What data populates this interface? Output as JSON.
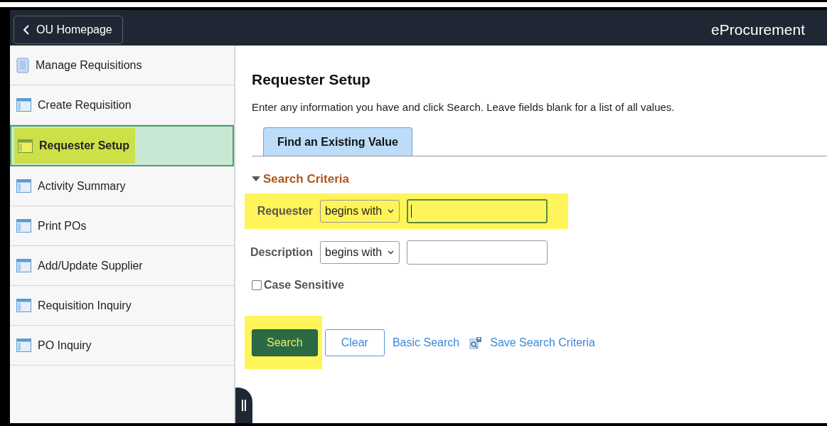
{
  "header": {
    "back_button": "OU Homepage",
    "title": "eProcurement"
  },
  "sidebar": {
    "items": [
      {
        "label": "Manage Requisitions",
        "kind": "list",
        "selected": false
      },
      {
        "label": "Create Requisition",
        "kind": "page",
        "selected": false
      },
      {
        "label": "Requester Setup",
        "kind": "page",
        "selected": true
      },
      {
        "label": "Activity Summary",
        "kind": "page",
        "selected": false
      },
      {
        "label": "Print POs",
        "kind": "page",
        "selected": false
      },
      {
        "label": "Add/Update Supplier",
        "kind": "page",
        "selected": false
      },
      {
        "label": "Requisition Inquiry",
        "kind": "page",
        "selected": false
      },
      {
        "label": "PO Inquiry",
        "kind": "page",
        "selected": false
      }
    ]
  },
  "page": {
    "title": "Requester Setup",
    "instructions": "Enter any information you have and click Search. Leave fields blank for a list of all values.",
    "tabs": [
      {
        "label": "Find an Existing Value",
        "selected": true
      }
    ],
    "section": {
      "title": "Search Criteria",
      "expanded": true
    },
    "criteria": [
      {
        "label": "Requester",
        "operator": "begins with",
        "highlighted": true,
        "focused": true
      },
      {
        "label": "Description",
        "operator": "begins with",
        "highlighted": false,
        "focused": false
      }
    ],
    "case_sensitive": {
      "label": "Case Sensitive",
      "checked": false
    },
    "buttons": [
      {
        "label": "Search",
        "kind": "primary",
        "highlighted": true
      },
      {
        "label": "Clear",
        "kind": "secondary",
        "highlighted": false
      }
    ],
    "links": [
      {
        "label": "Basic Search",
        "kind": "plain"
      },
      {
        "label": "Save Search Criteria",
        "kind": "save"
      }
    ]
  }
}
